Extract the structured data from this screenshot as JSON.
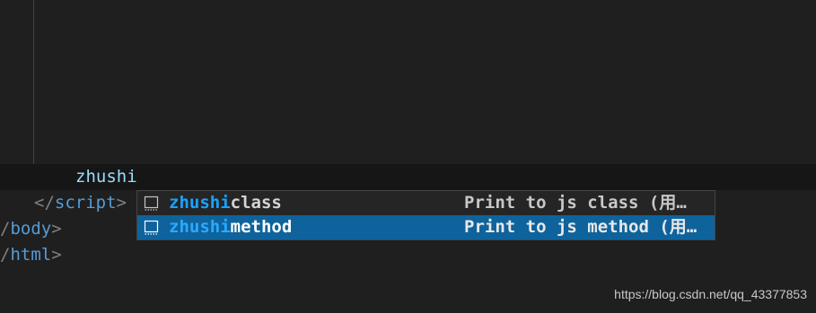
{
  "editor": {
    "typed_text": "zhushi",
    "lines": {
      "script_close": {
        "open": "</",
        "name": "script",
        "close": ">"
      },
      "body_close": {
        "open": "/",
        "name": "body",
        "close": ">"
      },
      "html_close": {
        "open": "/",
        "name": "html",
        "close": ">"
      }
    }
  },
  "suggestions": [
    {
      "match": "zhushi",
      "rest": "class",
      "detail": "Print to js class (用…",
      "icon": "snippet-icon",
      "selected": false
    },
    {
      "match": "zhushi",
      "rest": "method",
      "detail": "Print to js method (用…",
      "icon": "snippet-icon",
      "selected": true
    }
  ],
  "colors": {
    "background": "#1f1f1f",
    "selection": "#0e639c",
    "match_highlight": "#18a3ff",
    "tag": "#569cd6",
    "typed": "#9cdcfe"
  },
  "watermark": "https://blog.csdn.net/qq_43377853"
}
